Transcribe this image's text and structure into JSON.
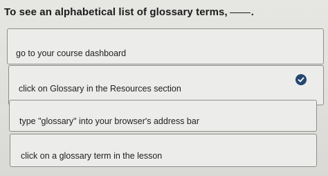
{
  "question": {
    "text": "To see an alphabetical list of glossary terms,",
    "period": "."
  },
  "options": [
    {
      "label": "go to your course dashboard"
    },
    {
      "label": "click on Glossary in the Resources section",
      "selected": true
    },
    {
      "label": "type \"glossary\" into your browser's address bar"
    },
    {
      "label": "click on a glossary term in the lesson"
    }
  ],
  "selection_icon": "check-circle-icon",
  "colors": {
    "accent": "#24476f",
    "card_bg": "#ececea",
    "border": "#8d8d8a",
    "page_bg": "#dcdcd8"
  }
}
